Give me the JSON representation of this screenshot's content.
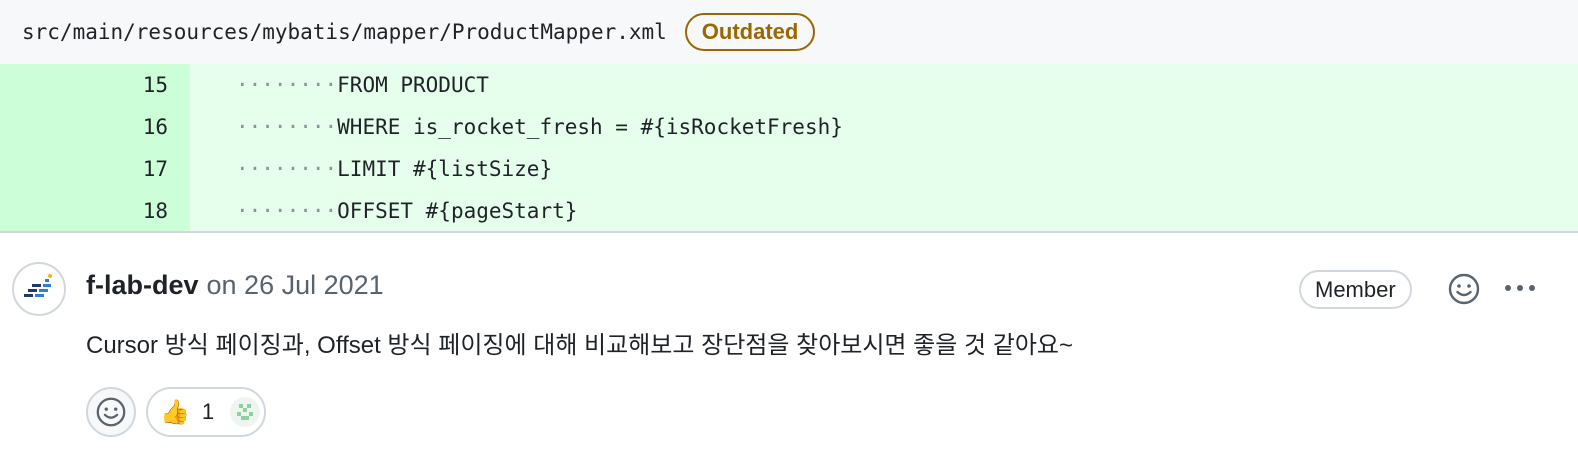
{
  "file": {
    "path": "src/main/resources/mybatis/mapper/ProductMapper.xml",
    "badge": "Outdated"
  },
  "diff": {
    "lines": [
      {
        "num": "15",
        "code": "FROM PRODUCT"
      },
      {
        "num": "16",
        "code": "WHERE is_rocket_fresh = #{isRocketFresh}"
      },
      {
        "num": "17",
        "code": "LIMIT #{listSize}"
      },
      {
        "num": "18",
        "code": "OFFSET #{pageStart}"
      }
    ],
    "indent_dots": "········"
  },
  "comment": {
    "author": "f-lab-dev",
    "date": "on 26 Jul 2021",
    "role_badge": "Member",
    "body": "Cursor 방식 페이징과, Offset 방식 페이징에 대해 비교해보고 장단점을 찾아보시면 좋을 것 같아요~",
    "reactions": [
      {
        "emoji": "👍",
        "count": "1"
      }
    ]
  },
  "icons": {
    "avatar": "f-lab-logo",
    "add_reaction": "smiley-icon",
    "more": "kebab-horizontal-icon",
    "reactor": "identicon-avatar"
  },
  "colors": {
    "badge_outdated": "#9a6700",
    "diff_added_bg": "#e6ffec",
    "diff_added_num_bg": "#ccffd8"
  }
}
